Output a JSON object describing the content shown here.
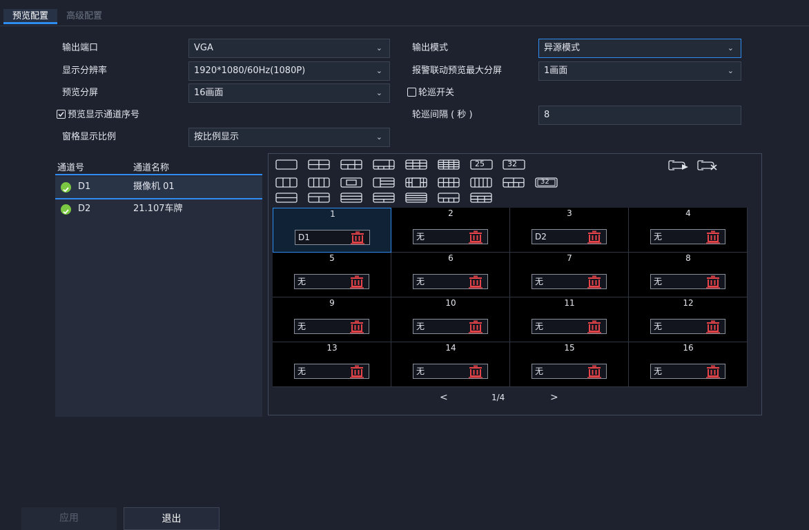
{
  "tabs": {
    "preview": "预览配置",
    "advanced": "高级配置"
  },
  "form": {
    "output_port_label": "输出端口",
    "output_port_value": "VGA",
    "resolution_label": "显示分辨率",
    "resolution_value": "1920*1080/60Hz(1080P)",
    "preview_split_label": "预览分屏",
    "preview_split_value": "16画面",
    "show_channel_no_label": "预览显示通道序号",
    "show_channel_no_checked": true,
    "aspect_label": "窗格显示比例",
    "aspect_value": "按比例显示",
    "output_mode_label": "输出模式",
    "output_mode_value": "异源模式",
    "alarm_max_split_label": "报警联动预览最大分屏",
    "alarm_max_split_value": "1画面",
    "patrol_switch_label": "轮巡开关",
    "patrol_switch_checked": false,
    "patrol_interval_label": "轮巡间隔 ( 秒 )",
    "patrol_interval_value": "8"
  },
  "channel_list": {
    "header_id": "通道号",
    "header_name": "通道名称",
    "rows": [
      {
        "id": "D1",
        "name": "摄像机 01",
        "status": "online"
      },
      {
        "id": "D2",
        "name": "21.107车牌",
        "status": "online"
      }
    ]
  },
  "layout_toolbar": {
    "label_25": "25",
    "label_32": "32",
    "label_32b": "32"
  },
  "grid": {
    "cells": [
      {
        "num": "1",
        "channel": "D1"
      },
      {
        "num": "2",
        "channel": "无"
      },
      {
        "num": "3",
        "channel": "D2"
      },
      {
        "num": "4",
        "channel": "无"
      },
      {
        "num": "5",
        "channel": "无"
      },
      {
        "num": "6",
        "channel": "无"
      },
      {
        "num": "7",
        "channel": "无"
      },
      {
        "num": "8",
        "channel": "无"
      },
      {
        "num": "9",
        "channel": "无"
      },
      {
        "num": "10",
        "channel": "无"
      },
      {
        "num": "11",
        "channel": "无"
      },
      {
        "num": "12",
        "channel": "无"
      },
      {
        "num": "13",
        "channel": "无"
      },
      {
        "num": "14",
        "channel": "无"
      },
      {
        "num": "15",
        "channel": "无"
      },
      {
        "num": "16",
        "channel": "无"
      }
    ],
    "selected_cell": "1"
  },
  "pager": {
    "prev": "<",
    "page": "1/4",
    "next": ">"
  },
  "buttons": {
    "apply": "应用",
    "exit": "退出"
  },
  "colors": {
    "accent": "#2f8cf0",
    "online": "#7bc943",
    "trash": "#e8444a"
  }
}
